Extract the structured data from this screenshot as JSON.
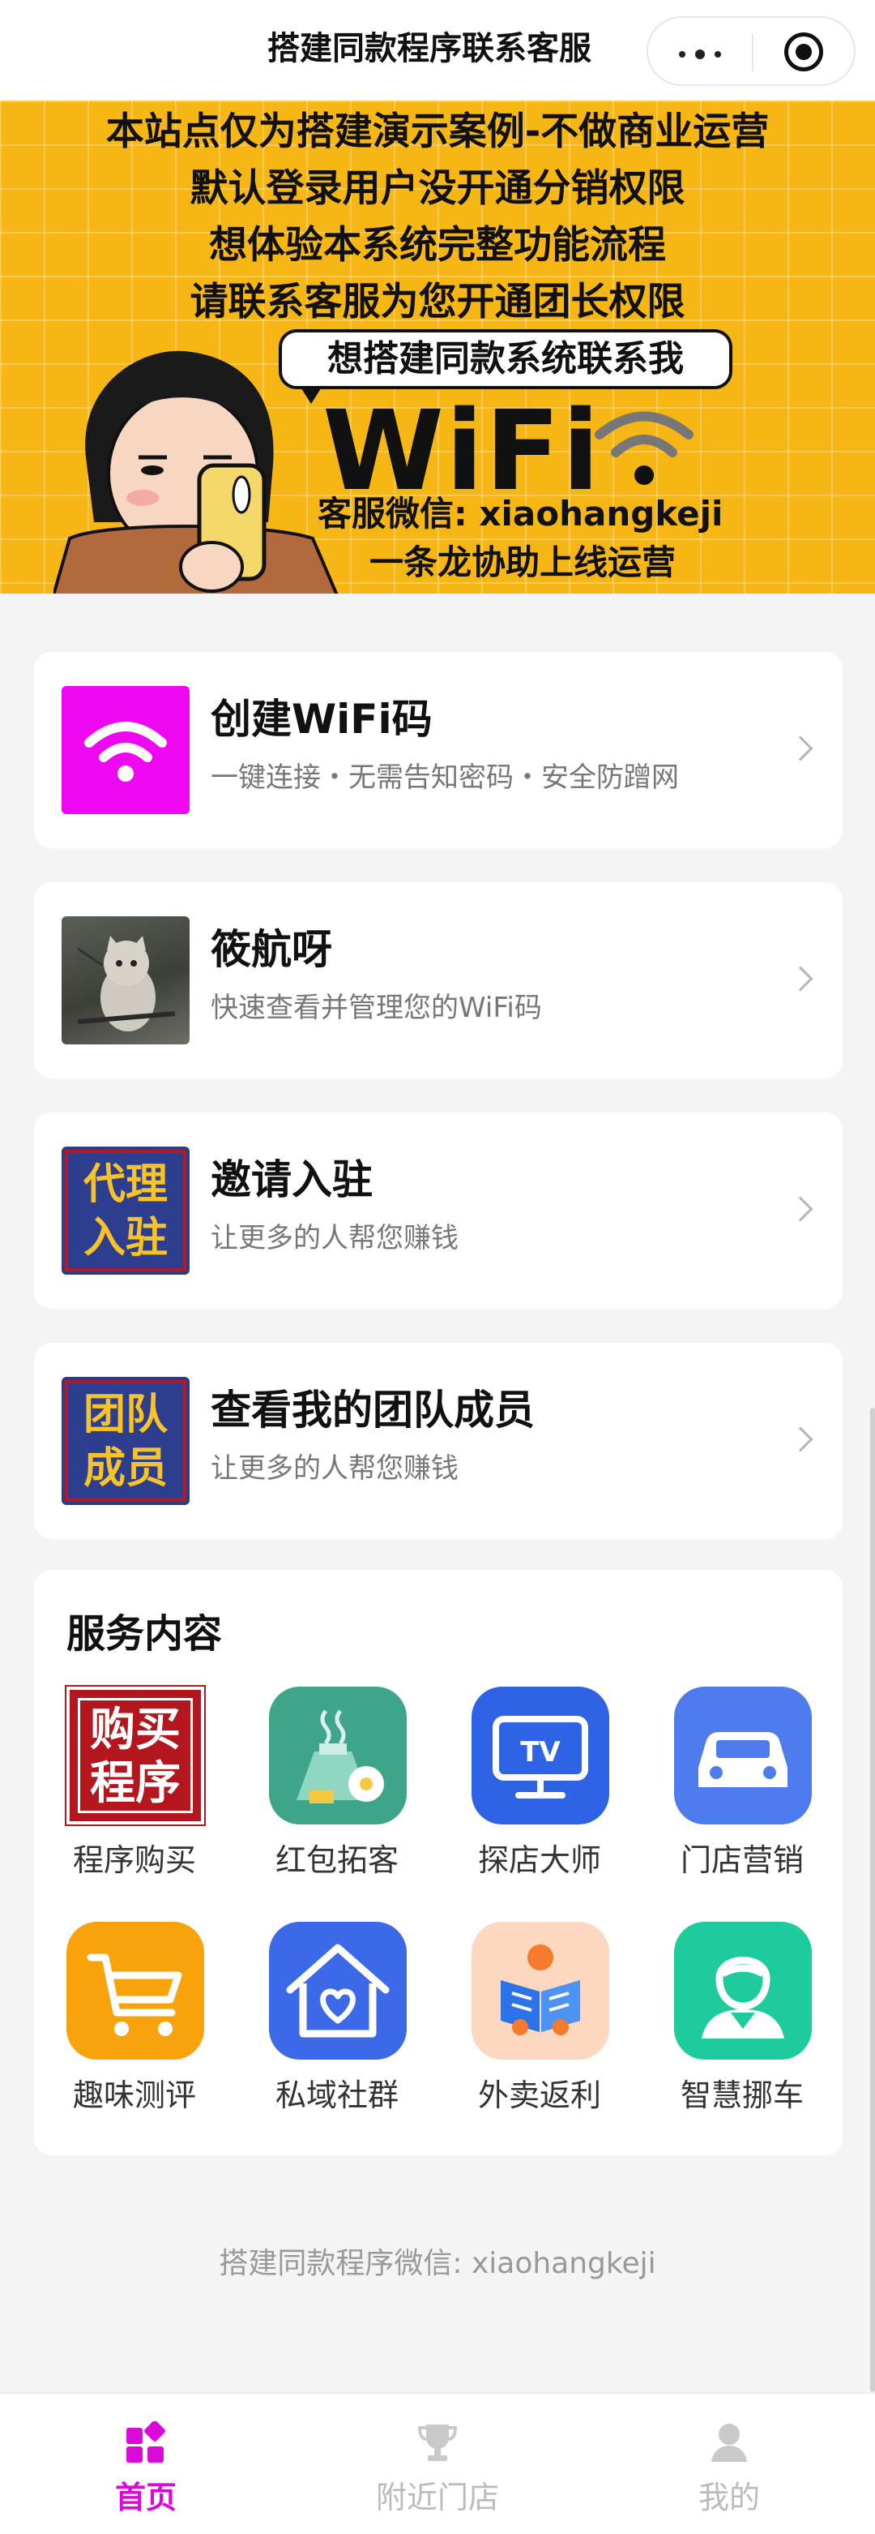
{
  "topbar": {
    "title": "搭建同款程序联系客服",
    "more_icon": "more-dots-icon",
    "close_icon": "target-close-icon"
  },
  "banner": {
    "lines": [
      "本站点仅为搭建演示案例-不做商业运营",
      "默认登录用户没开通分销权限",
      "想体验本系统完整功能流程",
      "请联系客服为您开通团长权限"
    ],
    "bubble": "想搭建同款系统联系我",
    "wifi_text": "WiFi",
    "contact": "客服微信: xiaohangkeji",
    "slogan": "一条龙协助上线运营"
  },
  "cards": [
    {
      "title": "创建WiFi码",
      "subtitle": "一键连接・无需告知密码・安全防蹭网",
      "icon": "wifi-icon"
    },
    {
      "title": "筱航呀",
      "subtitle": "快速查看并管理您的WiFi码",
      "icon": "cat-avatar"
    },
    {
      "title": "邀请入驻",
      "subtitle": "让更多的人帮您赚钱",
      "badge": "代理入驻"
    },
    {
      "title": "查看我的团队成员",
      "subtitle": "让更多的人帮您赚钱",
      "badge": "团队成员"
    }
  ],
  "badges": {
    "agent_line1": "代理",
    "agent_line2": "入驻",
    "team_line1": "团队",
    "team_line2": "成员"
  },
  "services": {
    "title": "服务内容",
    "items": [
      {
        "label": "程序购买",
        "icon": "buy-program-icon",
        "color": "#b3161c"
      },
      {
        "label": "红包拓客",
        "icon": "aroma-bottle-icon",
        "color": "#3fa58a"
      },
      {
        "label": "探店大师",
        "icon": "tv-icon",
        "color": "#2f63e6"
      },
      {
        "label": "门店营销",
        "icon": "car-icon",
        "color": "#4e7cef"
      },
      {
        "label": "趣味测评",
        "icon": "cart-icon",
        "color": "#f8a30b"
      },
      {
        "label": "私域社群",
        "icon": "house-heart-icon",
        "color": "#3c69e8"
      },
      {
        "label": "外卖返利",
        "icon": "reading-person-icon",
        "color": "#fbd8bf"
      },
      {
        "label": "智慧挪车",
        "icon": "person-icon",
        "color": "#1dcb9d"
      }
    ],
    "buy_icon_line1": "购买",
    "buy_icon_line2": "程序",
    "tv_text": "TV"
  },
  "footer_note": "搭建同款程序微信: xiaohangkeji",
  "tabbar": {
    "tabs": [
      {
        "label": "首页",
        "icon": "home-grid-icon",
        "active": true
      },
      {
        "label": "附近门店",
        "icon": "trophy-icon",
        "active": false
      },
      {
        "label": "我的",
        "icon": "user-icon",
        "active": false
      }
    ]
  },
  "colors": {
    "accent": "#d90ad8",
    "banner_bg": "#f6b614",
    "wifi_thumb": "#ee07f0"
  }
}
